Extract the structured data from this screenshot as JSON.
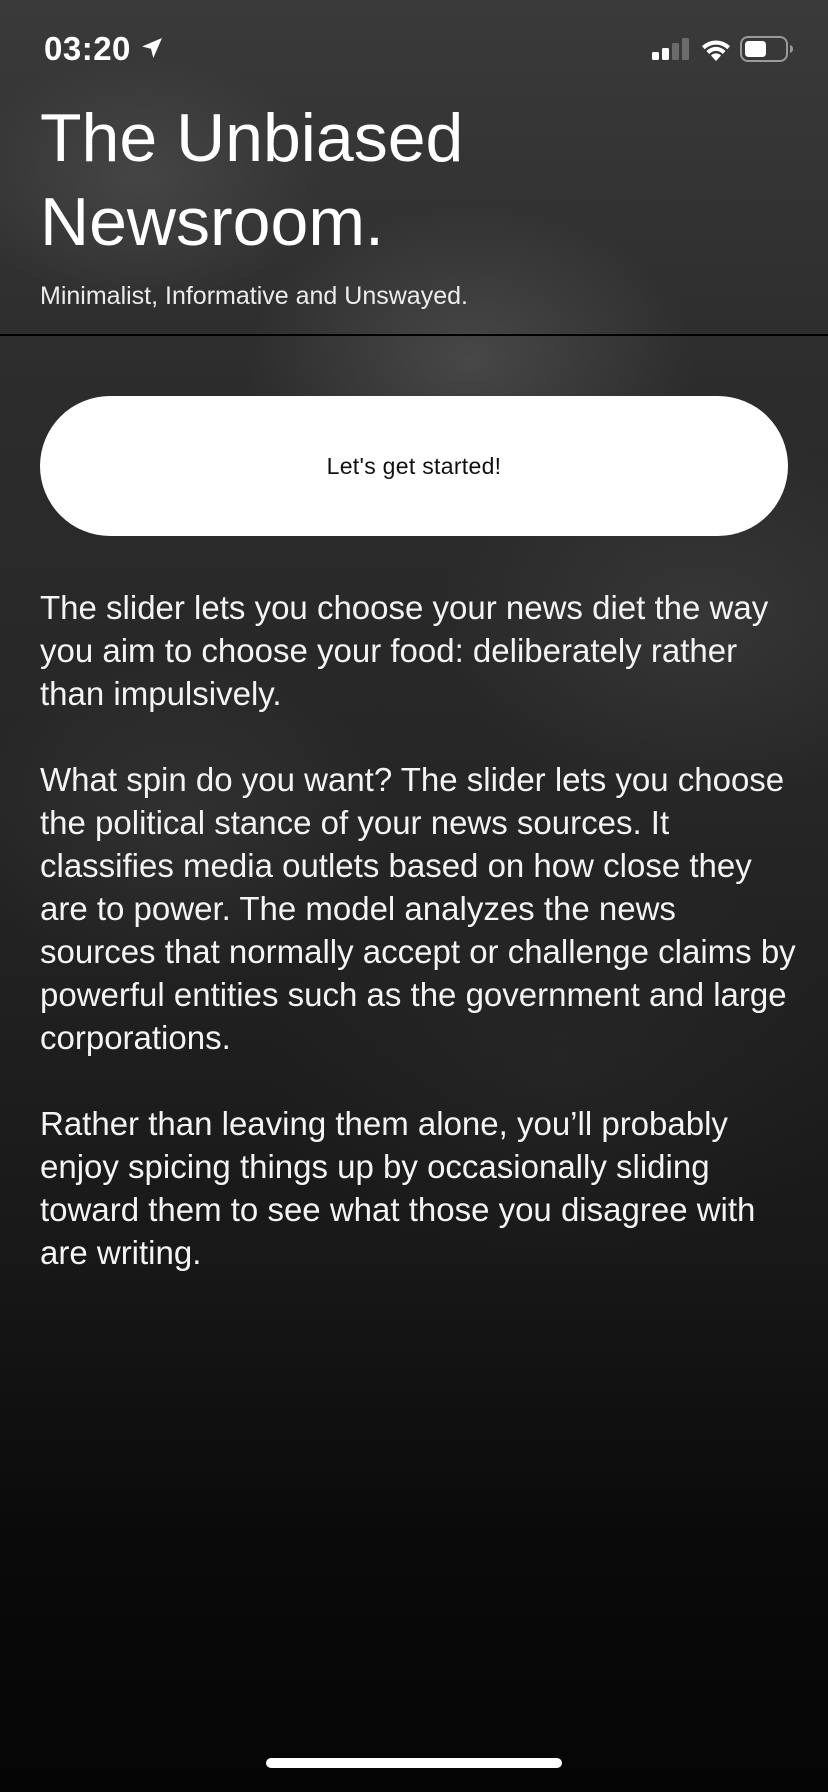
{
  "status_bar": {
    "time": "03:20",
    "icons": [
      "location-icon",
      "signal-icon",
      "wifi-icon",
      "battery-icon"
    ]
  },
  "header": {
    "title": "The Unbiased Newsroom.",
    "subtitle": "Minimalist, Informative and Unswayed."
  },
  "cta": {
    "label": "Let's get started!"
  },
  "body": {
    "paragraphs": [
      "The slider lets you choose your news diet the way you aim to choose your food: deliberately rather than impulsively.",
      "What spin do you want? The slider lets you choose the political stance of your news sources. It classifies media outlets based on how close they are to power. The model analyzes the news sources that normally accept or challenge claims by powerful entities such as the government and large corporations.",
      "Rather than leaving them alone, you’ll probably enjoy spicing things up by occasionally sliding toward them to see what those you disagree with are writing."
    ]
  },
  "colors": {
    "background": "#2a2a2a",
    "text": "#ffffff",
    "button_bg": "#ffffff",
    "button_text": "#111111",
    "divider": "#000000"
  }
}
